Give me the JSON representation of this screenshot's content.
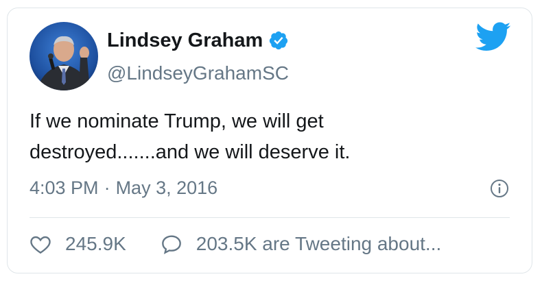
{
  "author": {
    "display_name": "Lindsey Graham",
    "handle": "@LindseyGrahamSC",
    "verified": true
  },
  "tweet": {
    "text_line1": "If we nominate Trump, we will get",
    "text_line2": "destroyed.......and we will deserve it.",
    "time": "4:03 PM",
    "separator": "·",
    "date": "May 3, 2016"
  },
  "stats": {
    "likes": "245.9K",
    "tweeting_about": "203.5K are Tweeting about..."
  },
  "icons": {
    "brand": "twitter-bird-icon",
    "verified": "verified-badge-icon",
    "info": "info-icon",
    "like": "heart-icon",
    "reply": "speech-bubble-icon"
  },
  "colors": {
    "brand": "#1da1f2",
    "text": "#14171a",
    "secondary": "#657786",
    "border": "#dfe5e9"
  }
}
